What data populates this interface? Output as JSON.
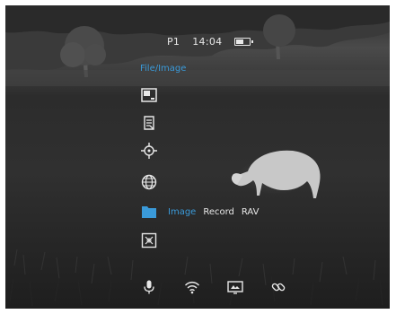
{
  "status_bar": {
    "profile": "P1",
    "time": "14:04",
    "battery_level": 0.6,
    "battery_icon": "battery-icon"
  },
  "menu": {
    "title": "File/Image",
    "items": [
      {
        "icon": "picture-in-picture-icon",
        "selected": false
      },
      {
        "icon": "file-list-icon",
        "selected": false
      },
      {
        "icon": "crosshair-icon",
        "selected": false
      },
      {
        "icon": "globe-icon",
        "selected": false
      },
      {
        "icon": "folder-icon",
        "selected": true
      },
      {
        "icon": "zoom-frame-icon",
        "selected": false
      }
    ],
    "submenu": {
      "options": [
        "Image",
        "Record",
        "RAV"
      ],
      "active": "Image"
    }
  },
  "bottom_icons": [
    "microphone-icon",
    "wifi-icon",
    "display-mode-icon",
    "link-icon"
  ],
  "colors": {
    "accent": "#3a9ad9",
    "foreground": "#e8e8e8"
  }
}
